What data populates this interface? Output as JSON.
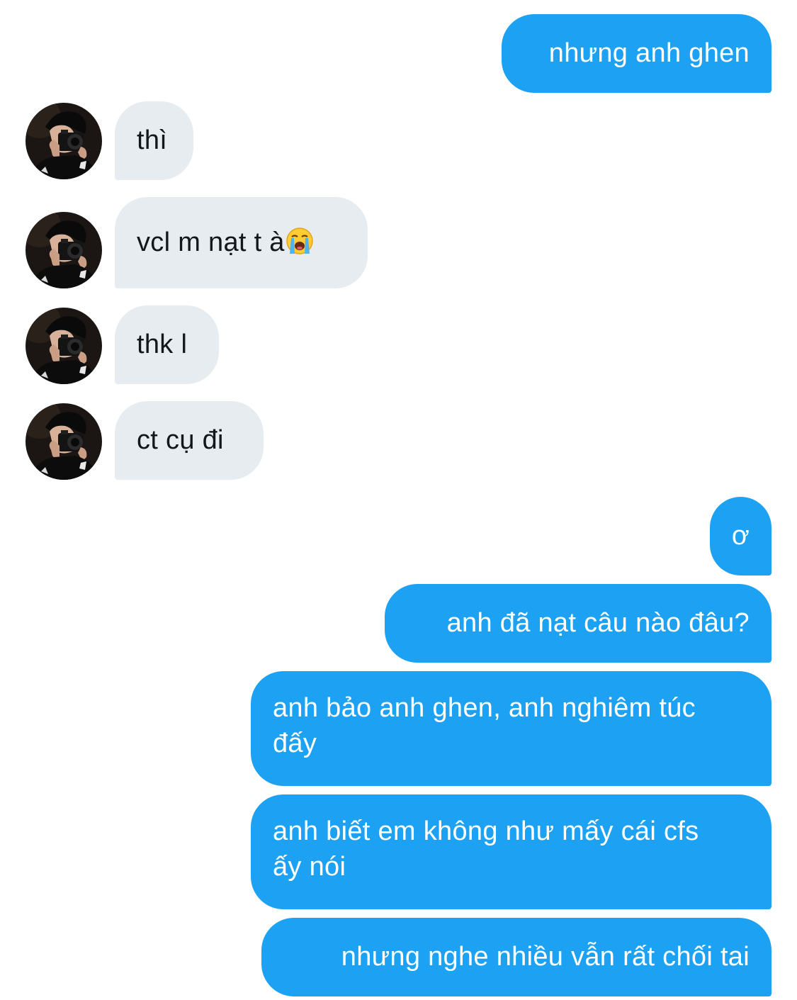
{
  "conversation": {
    "messages": [
      {
        "id": "m1",
        "direction": "outgoing",
        "text": "nhưng anh ghen"
      },
      {
        "id": "m2",
        "direction": "incoming",
        "text": "thì"
      },
      {
        "id": "m3",
        "direction": "incoming",
        "text": "vcl m nạt t à",
        "emoji": "loudly-crying-face"
      },
      {
        "id": "m4",
        "direction": "incoming",
        "text": "thk l"
      },
      {
        "id": "m5",
        "direction": "incoming",
        "text": "ct cụ đi"
      },
      {
        "id": "m6",
        "direction": "outgoing",
        "text": "ơ"
      },
      {
        "id": "m7",
        "direction": "outgoing",
        "text": "anh đã nạt câu nào đâu?"
      },
      {
        "id": "m8",
        "direction": "outgoing",
        "text": "anh bảo anh ghen, anh nghiêm túc đấy"
      },
      {
        "id": "m9",
        "direction": "outgoing",
        "text": "anh biết em không như mấy cái cfs ấy nói"
      },
      {
        "id": "m10",
        "direction": "outgoing",
        "text": "nhưng nghe nhiều vẫn rất chối tai"
      }
    ]
  },
  "colors": {
    "outgoing_bubble": "#1da1f2",
    "incoming_bubble": "#e6ecf0",
    "incoming_text": "#14171a",
    "outgoing_text": "#ffffff"
  },
  "icons": {
    "avatar": "contact-avatar-photo",
    "emoji": "loudly-crying-face-emoji"
  }
}
